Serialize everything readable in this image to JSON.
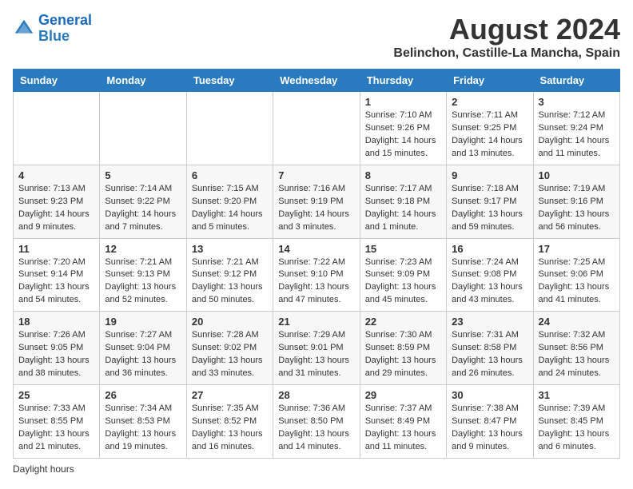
{
  "logo": {
    "line1": "General",
    "line2": "Blue"
  },
  "title": "August 2024",
  "subtitle": "Belinchon, Castille-La Mancha, Spain",
  "days_of_week": [
    "Sunday",
    "Monday",
    "Tuesday",
    "Wednesday",
    "Thursday",
    "Friday",
    "Saturday"
  ],
  "footer_label": "Daylight hours",
  "weeks": [
    [
      {
        "day": "",
        "info": ""
      },
      {
        "day": "",
        "info": ""
      },
      {
        "day": "",
        "info": ""
      },
      {
        "day": "",
        "info": ""
      },
      {
        "day": "1",
        "info": "Sunrise: 7:10 AM\nSunset: 9:26 PM\nDaylight: 14 hours and 15 minutes."
      },
      {
        "day": "2",
        "info": "Sunrise: 7:11 AM\nSunset: 9:25 PM\nDaylight: 14 hours and 13 minutes."
      },
      {
        "day": "3",
        "info": "Sunrise: 7:12 AM\nSunset: 9:24 PM\nDaylight: 14 hours and 11 minutes."
      }
    ],
    [
      {
        "day": "4",
        "info": "Sunrise: 7:13 AM\nSunset: 9:23 PM\nDaylight: 14 hours and 9 minutes."
      },
      {
        "day": "5",
        "info": "Sunrise: 7:14 AM\nSunset: 9:22 PM\nDaylight: 14 hours and 7 minutes."
      },
      {
        "day": "6",
        "info": "Sunrise: 7:15 AM\nSunset: 9:20 PM\nDaylight: 14 hours and 5 minutes."
      },
      {
        "day": "7",
        "info": "Sunrise: 7:16 AM\nSunset: 9:19 PM\nDaylight: 14 hours and 3 minutes."
      },
      {
        "day": "8",
        "info": "Sunrise: 7:17 AM\nSunset: 9:18 PM\nDaylight: 14 hours and 1 minute."
      },
      {
        "day": "9",
        "info": "Sunrise: 7:18 AM\nSunset: 9:17 PM\nDaylight: 13 hours and 59 minutes."
      },
      {
        "day": "10",
        "info": "Sunrise: 7:19 AM\nSunset: 9:16 PM\nDaylight: 13 hours and 56 minutes."
      }
    ],
    [
      {
        "day": "11",
        "info": "Sunrise: 7:20 AM\nSunset: 9:14 PM\nDaylight: 13 hours and 54 minutes."
      },
      {
        "day": "12",
        "info": "Sunrise: 7:21 AM\nSunset: 9:13 PM\nDaylight: 13 hours and 52 minutes."
      },
      {
        "day": "13",
        "info": "Sunrise: 7:21 AM\nSunset: 9:12 PM\nDaylight: 13 hours and 50 minutes."
      },
      {
        "day": "14",
        "info": "Sunrise: 7:22 AM\nSunset: 9:10 PM\nDaylight: 13 hours and 47 minutes."
      },
      {
        "day": "15",
        "info": "Sunrise: 7:23 AM\nSunset: 9:09 PM\nDaylight: 13 hours and 45 minutes."
      },
      {
        "day": "16",
        "info": "Sunrise: 7:24 AM\nSunset: 9:08 PM\nDaylight: 13 hours and 43 minutes."
      },
      {
        "day": "17",
        "info": "Sunrise: 7:25 AM\nSunset: 9:06 PM\nDaylight: 13 hours and 41 minutes."
      }
    ],
    [
      {
        "day": "18",
        "info": "Sunrise: 7:26 AM\nSunset: 9:05 PM\nDaylight: 13 hours and 38 minutes."
      },
      {
        "day": "19",
        "info": "Sunrise: 7:27 AM\nSunset: 9:04 PM\nDaylight: 13 hours and 36 minutes."
      },
      {
        "day": "20",
        "info": "Sunrise: 7:28 AM\nSunset: 9:02 PM\nDaylight: 13 hours and 33 minutes."
      },
      {
        "day": "21",
        "info": "Sunrise: 7:29 AM\nSunset: 9:01 PM\nDaylight: 13 hours and 31 minutes."
      },
      {
        "day": "22",
        "info": "Sunrise: 7:30 AM\nSunset: 8:59 PM\nDaylight: 13 hours and 29 minutes."
      },
      {
        "day": "23",
        "info": "Sunrise: 7:31 AM\nSunset: 8:58 PM\nDaylight: 13 hours and 26 minutes."
      },
      {
        "day": "24",
        "info": "Sunrise: 7:32 AM\nSunset: 8:56 PM\nDaylight: 13 hours and 24 minutes."
      }
    ],
    [
      {
        "day": "25",
        "info": "Sunrise: 7:33 AM\nSunset: 8:55 PM\nDaylight: 13 hours and 21 minutes."
      },
      {
        "day": "26",
        "info": "Sunrise: 7:34 AM\nSunset: 8:53 PM\nDaylight: 13 hours and 19 minutes."
      },
      {
        "day": "27",
        "info": "Sunrise: 7:35 AM\nSunset: 8:52 PM\nDaylight: 13 hours and 16 minutes."
      },
      {
        "day": "28",
        "info": "Sunrise: 7:36 AM\nSunset: 8:50 PM\nDaylight: 13 hours and 14 minutes."
      },
      {
        "day": "29",
        "info": "Sunrise: 7:37 AM\nSunset: 8:49 PM\nDaylight: 13 hours and 11 minutes."
      },
      {
        "day": "30",
        "info": "Sunrise: 7:38 AM\nSunset: 8:47 PM\nDaylight: 13 hours and 9 minutes."
      },
      {
        "day": "31",
        "info": "Sunrise: 7:39 AM\nSunset: 8:45 PM\nDaylight: 13 hours and 6 minutes."
      }
    ]
  ]
}
